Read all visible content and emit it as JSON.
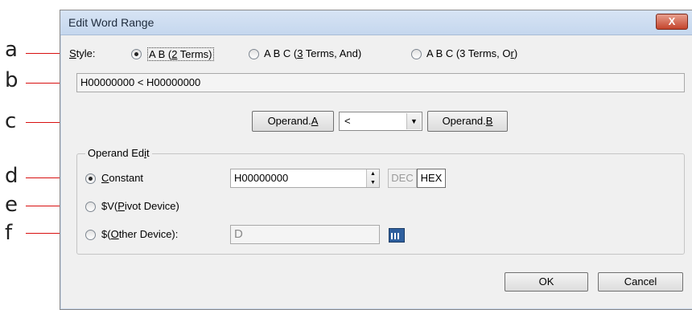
{
  "callouts": [
    "a",
    "b",
    "c",
    "d",
    "e",
    "f"
  ],
  "dialog": {
    "title": "Edit Word Range",
    "close_glyph": "X"
  },
  "style": {
    "label_key": "S",
    "label_rest": "tyle:",
    "options": [
      {
        "pre": "A B (",
        "key": "2",
        "post": " Terms)",
        "checked": true
      },
      {
        "pre": "A B C (",
        "key": "3",
        "post": " Terms, And)",
        "checked": false
      },
      {
        "pre": "A B C (3 Terms, O",
        "key": "r",
        "post": ")",
        "checked": false
      }
    ]
  },
  "expression": "H00000000 < H00000000",
  "operands": {
    "a_pre": "Operand.",
    "a_key": "A",
    "operator_value": "<",
    "b_pre": "Operand.",
    "b_key": "B"
  },
  "operand_edit": {
    "title_pre": "Operand Ed",
    "title_key": "i",
    "title_post": "t",
    "constant": {
      "key": "C",
      "rest": "onstant",
      "checked": true,
      "value": "H00000000"
    },
    "pivot": {
      "pre": "$V(",
      "key": "P",
      "post": "ivot Device)",
      "checked": false
    },
    "other": {
      "pre": "$(",
      "key": "O",
      "post": "ther Device):",
      "checked": false,
      "value": "D"
    },
    "dec_label": "DEC",
    "hex_label": "HEX"
  },
  "buttons": {
    "ok": "OK",
    "cancel": "Cancel"
  }
}
